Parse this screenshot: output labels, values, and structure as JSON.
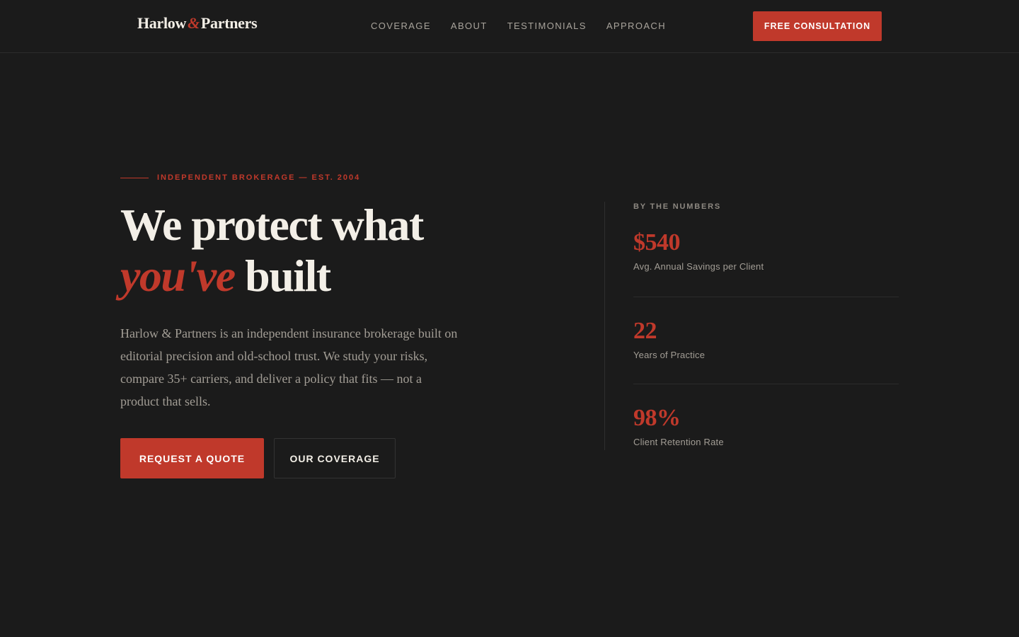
{
  "header": {
    "logo": {
      "part1": "Harlow",
      "amp": "&",
      "part2": "Partners"
    },
    "nav": [
      {
        "label": "COVERAGE"
      },
      {
        "label": "ABOUT"
      },
      {
        "label": "TESTIMONIALS"
      },
      {
        "label": "APPROACH"
      }
    ],
    "cta_label": "FREE CONSULTATION"
  },
  "hero": {
    "eyebrow": "INDEPENDENT BROKERAGE — EST. 2004",
    "headline_line1": "We protect what",
    "headline_accent": "you've",
    "headline_line2_rest": "built",
    "lede": "Harlow & Partners is an independent insurance brokerage built on editorial precision and old-school trust. We study your risks, compare 35+ carriers, and deliver a policy that fits — not a product that sells.",
    "primary_button": "REQUEST A QUOTE",
    "secondary_button": "OUR COVERAGE"
  },
  "stats": {
    "heading": "BY THE NUMBERS",
    "items": [
      {
        "value": "$540",
        "label": "Avg. Annual Savings per Client"
      },
      {
        "value": "22",
        "label": "Years of Practice"
      },
      {
        "value": "98%",
        "label": "Client Retention Rate"
      }
    ]
  },
  "colors": {
    "background": "#1b1b1b",
    "accent": "#c0392b",
    "text_primary": "#f3efe7",
    "text_muted": "#a29d95"
  }
}
